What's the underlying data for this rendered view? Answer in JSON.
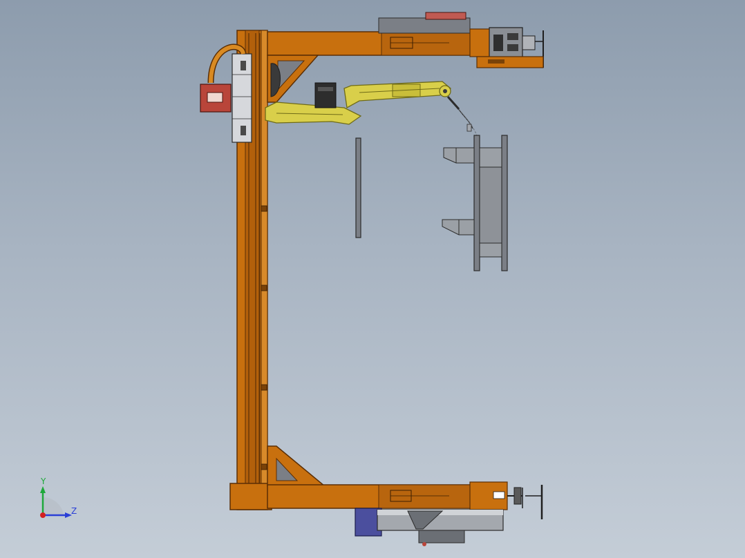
{
  "triad": {
    "y_label": "Y",
    "z_label": "Z",
    "y_color": "#1ea83a",
    "z_color": "#2a3fd6",
    "x_color": "#d42020"
  },
  "colors": {
    "background_top": "#8d9cad",
    "background_bottom": "#c4cdd7",
    "frame_orange": "#c8700e",
    "frame_dark": "#5a2e05",
    "robot_yellow": "#d9cf4a",
    "robot_dark": "#6e6a17",
    "steel_gray": "#7b7f86",
    "motor_blue": "#4b4f9e",
    "accent_red": "#b9453a"
  },
  "model": {
    "components": [
      "gantry-column",
      "upper-arm-beam",
      "lower-arm-beam",
      "welding-robot",
      "welding-torch",
      "workpiece-frame",
      "side-panel",
      "drive-motor",
      "control-box",
      "cable-loop"
    ]
  }
}
